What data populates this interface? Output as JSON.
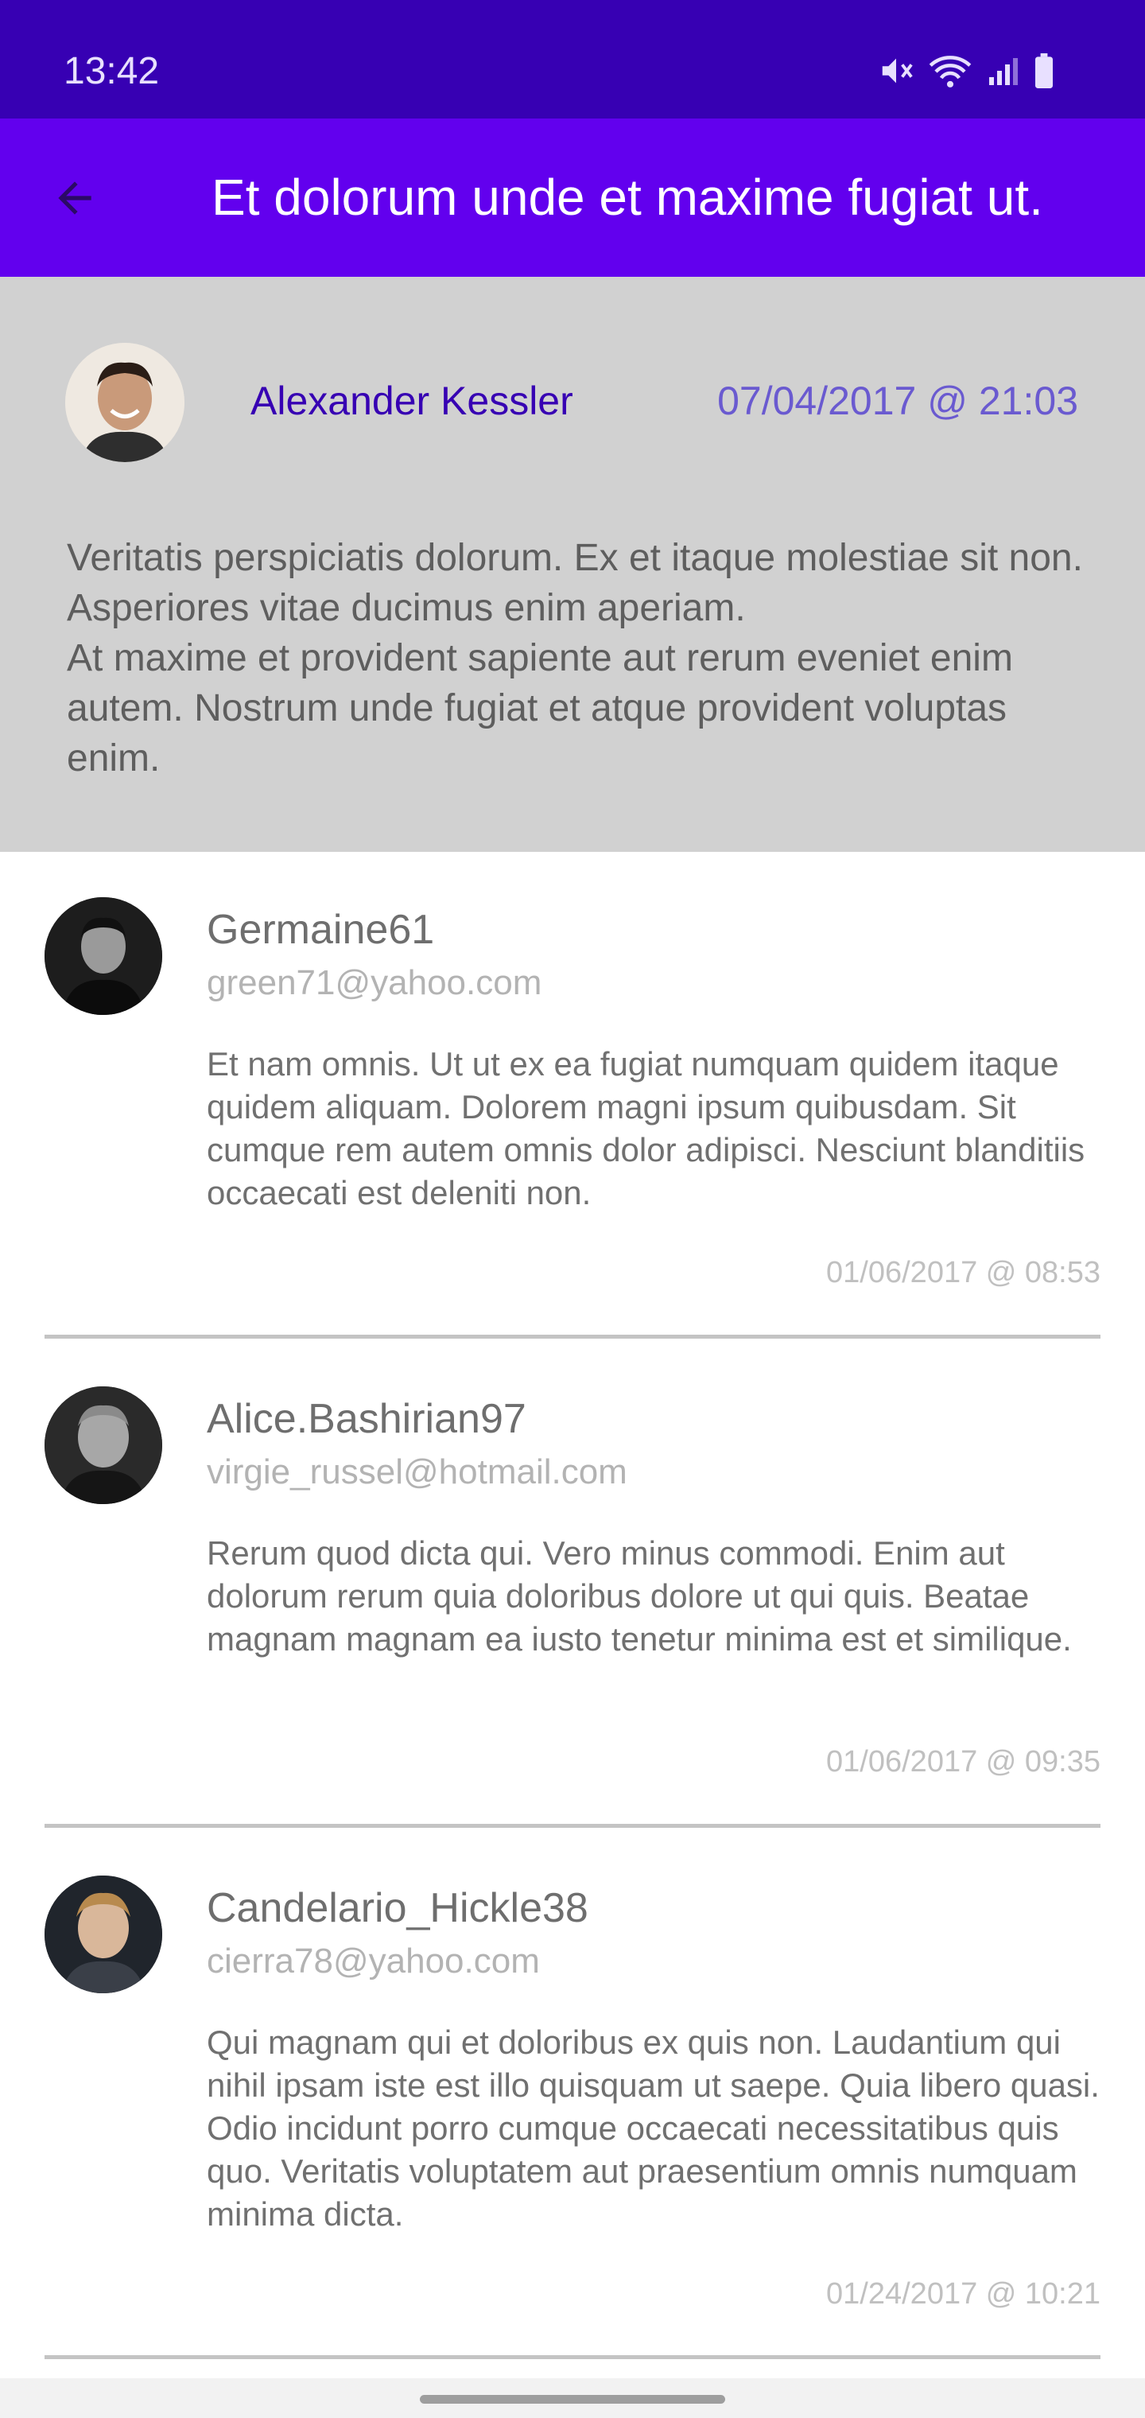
{
  "status_bar": {
    "time": "13:42",
    "icons": [
      "mute-icon",
      "wifi-icon",
      "signal-icon",
      "battery-icon"
    ]
  },
  "app_bar": {
    "title": "Et dolorum unde et maxime fugiat ut.",
    "back_icon": "arrow-back-icon"
  },
  "post": {
    "author": "Alexander Kessler",
    "date": "07/04/2017 @ 21:03",
    "body": "Veritatis perspiciatis dolorum. Ex et itaque molestiae sit non. Asperiores vitae ducimus enim aperiam.\nAt maxime et provident sapiente aut rerum eveniet enim autem. Nostrum unde fugiat et atque provident voluptas enim."
  },
  "comments": [
    {
      "username": "Germaine61",
      "email": "green71@yahoo.com",
      "body": "Et nam omnis. Ut ut ex ea fugiat numquam quidem itaque quidem aliquam. Dolorem magni ipsum quibusdam. Sit cumque rem autem omnis dolor adipisci. Nesciunt blanditiis occaecati est deleniti non.",
      "date": "01/06/2017 @ 08:53"
    },
    {
      "username": "Alice.Bashirian97",
      "email": "virgie_russel@hotmail.com",
      "body": "Rerum quod dicta qui. Vero minus commodi. Enim aut dolorum rerum quia doloribus dolore ut qui quis. Beatae magnam magnam ea iusto tenetur minima est et similique.",
      "date": "01/06/2017 @ 09:35"
    },
    {
      "username": "Candelario_Hickle38",
      "email": "cierra78@yahoo.com",
      "body": "Qui magnam qui et doloribus ex quis non. Laudantium qui nihil ipsam iste est illo quisquam ut saepe. Quia libero quasi. Odio incidunt porro cumque occaecati necessitatibus quis quo. Veritatis voluptatem aut praesentium omnis numquam minima dicta.",
      "date": "01/24/2017 @ 10:21"
    }
  ],
  "colors": {
    "status_bar": "#3700b3",
    "app_bar": "#6200ee",
    "post_header_bg": "#d1d1d1",
    "author_link": "#3700b3"
  }
}
